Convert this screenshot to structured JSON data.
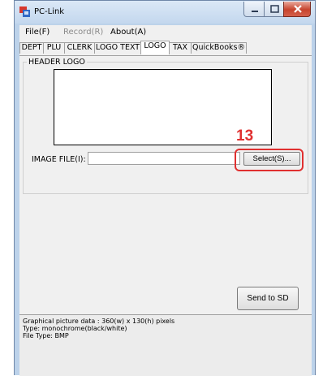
{
  "window": {
    "title": "PC-Link",
    "controls": {
      "minimize": "minimize-icon",
      "maximize": "maximize-icon",
      "close": "close-icon"
    }
  },
  "menu": [
    {
      "label": "File(F)",
      "disabled": false
    },
    {
      "label": "Record(R)",
      "disabled": true
    },
    {
      "label": "About(A)",
      "disabled": false
    }
  ],
  "tabs": [
    {
      "label": "DEPT",
      "active": false
    },
    {
      "label": "PLU",
      "active": false
    },
    {
      "label": "CLERK",
      "active": false
    },
    {
      "label": "LOGO TEXT",
      "active": false
    },
    {
      "label": "LOGO",
      "active": true
    },
    {
      "label": "TAX",
      "active": false
    },
    {
      "label": "QuickBooks®",
      "active": false
    }
  ],
  "header_logo": {
    "group_label": "HEADER LOGO",
    "image_file_label": "IMAGE FILE(I):",
    "image_file_value": "",
    "select_button": "Select(S)..."
  },
  "callout": {
    "number": "13",
    "color": "#e03030"
  },
  "send_button": "Send to SD",
  "info": {
    "lines": [
      "Graphical picture data : 360(w) x 130(h) pixels",
      "Type: monochrome(black/white)",
      "File Type: BMP"
    ]
  },
  "colors": {
    "window_frame": "#bcd2ea",
    "client_bg": "#f0f0f0",
    "accent_red": "#e03030"
  }
}
